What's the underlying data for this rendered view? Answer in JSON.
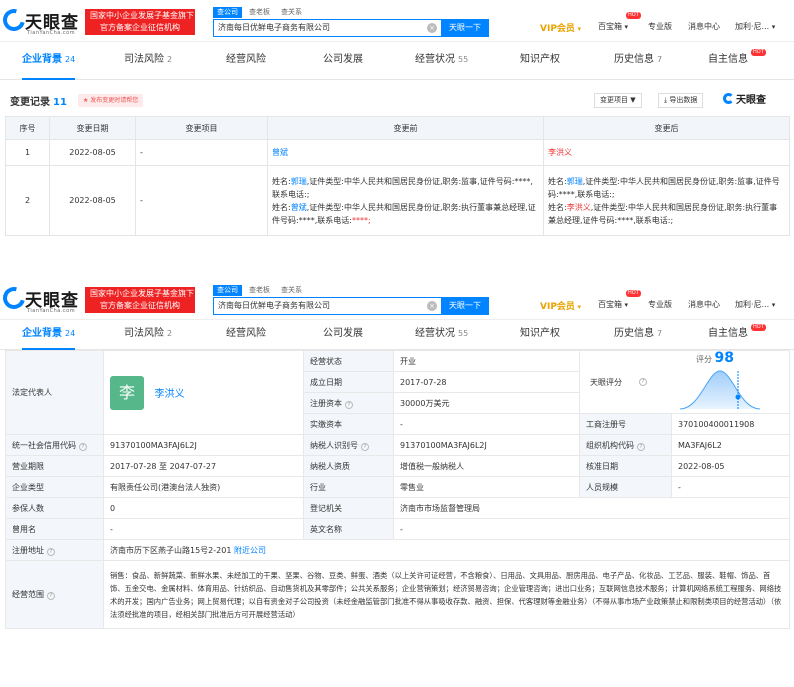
{
  "header": {
    "logo_text": "天眼查",
    "logo_sub": "TianYanCha.com",
    "promo_line1": "国家中小企业发展子基金旗下",
    "promo_line2": "官方备案企业征信机构",
    "search_tabs": [
      "查公司",
      "查老板",
      "查关系"
    ],
    "search_value": "济南每日优鲜电子商务有限公司",
    "search_clear": "×",
    "search_button": "天眼一下",
    "vip": "VIP会员",
    "baibao": "百宝箱",
    "hot": "HOT",
    "pro": "专业版",
    "messages": "消息中心",
    "user": "加利·尼..."
  },
  "tabs": [
    {
      "label": "企业背景",
      "count": "24"
    },
    {
      "label": "司法风险",
      "count": "2"
    },
    {
      "label": "经营风险",
      "count": ""
    },
    {
      "label": "公司发展",
      "count": ""
    },
    {
      "label": "经营状况",
      "count": "55"
    },
    {
      "label": "知识产权",
      "count": ""
    },
    {
      "label": "历史信息",
      "count": "7"
    },
    {
      "label": "自主信息",
      "count": ""
    }
  ],
  "change_section": {
    "title": "变更记录",
    "count": "11",
    "badge": "★ 发布变更时请帮您",
    "filter": "变更项目 ▼",
    "export": "⤓ 导出数据",
    "brand": "天眼查",
    "columns": [
      "序号",
      "变更日期",
      "变更项目",
      "变更前",
      "变更后"
    ],
    "rows": [
      {
        "index": "1",
        "date": "2022-08-05",
        "item": "-",
        "before_name": "曾斌",
        "after_name": "李洪义"
      },
      {
        "index": "2",
        "date": "2022-08-05",
        "item": "-",
        "before_1_prefix": "姓名:",
        "before_1_name": "郭瑞",
        "before_1_rest": ",证件类型:中华人民共和国居民身份证,职务:监事,证件号码:****,联系电话:;",
        "before_2_prefix": "姓名:",
        "before_2_name": "曾斌",
        "before_2_rest": ",证件类型:中华人民共和国居民身份证,职务:执行董事兼总经理,证件号码:****,联系电话:",
        "before_2_tail": "****;",
        "after_1_prefix": "姓名:",
        "after_1_name": "郭瑞",
        "after_1_rest": ",证件类型:中华人民共和国居民身份证,职务:监事,证件号码:****,联系电话:;",
        "after_2_prefix": "姓名:",
        "after_2_name": "李洪义",
        "after_2_rest": ",证件类型:中华人民共和国居民身份证,职务:执行董事兼总经理,证件号码:****,联系电话:;"
      }
    ]
  },
  "info": {
    "legal_rep_label": "法定代表人",
    "legal_rep_avatar": "李",
    "legal_rep_name": "李洪义",
    "status_label": "经营状态",
    "status_value": "开业",
    "score_label": "评分",
    "score_value": "98",
    "founded_label": "成立日期",
    "founded_value": "2017-07-28",
    "tianyan_score_label": "天眼评分",
    "reg_capital_label": "注册资本",
    "reg_capital_value": "30000万美元",
    "paid_capital_label": "实缴资本",
    "paid_capital_value": "-",
    "biz_reg_no_label": "工商注册号",
    "biz_reg_no_value": "370100400011908",
    "credit_code_label": "统一社会信用代码",
    "credit_code_value": "91370100MA3FAJ6L2J",
    "taxpayer_id_label": "纳税人识别号",
    "taxpayer_id_value": "91370100MA3FAJ6L2J",
    "org_code_label": "组织机构代码",
    "org_code_value": "MA3FAJ6L2",
    "term_label": "营业期限",
    "term_value": "2017-07-28 至 2047-07-27",
    "taxpayer_type_label": "纳税人资质",
    "taxpayer_type_value": "增值税一般纳税人",
    "approval_date_label": "核准日期",
    "approval_date_value": "2022-08-05",
    "company_type_label": "企业类型",
    "company_type_value": "有限责任公司(港澳台法人独资)",
    "industry_label": "行业",
    "industry_value": "零售业",
    "staff_size_label": "人员规模",
    "staff_size_value": "-",
    "insured_label": "参保人数",
    "insured_value": "0",
    "reg_authority_label": "登记机关",
    "reg_authority_value": "济南市市场监督管理局",
    "former_name_label": "曾用名",
    "former_name_value": "-",
    "english_name_label": "英文名称",
    "english_name_value": "-",
    "address_label": "注册地址",
    "address_value": "济南市历下区燕子山路15号2-201",
    "nearby_link": "附近公司",
    "scope_label": "经营范围",
    "scope_value": "销售：食品、新鲜蔬菜、新鲜水果、未经加工的干果、坚果、谷物、豆类、鲜蛋、酒类（以上关许可证经营，不含粮食）、日用品、文具用品、厨房用品、电子产品、化妆品、工艺品、服装、鞋帽、饰品、首饰、五金交电、金属材料、体育用品、针纺织品、自动售货机及其零部件；公共关系服务；企业营销策划；经济贸易咨询；企业管理咨询；进出口业务；互联网信息技术服务；计算机网络系统工程服务、网络技术的开发；国内广告业务；网上贸易代理；以自有资金对子公司投资（未经金融监管部门批准不得从事吸收存款、融资、担保、代客理财等金融业务）（不得从事市场产业政策禁止和限制类项目的经营活动）（依法须经批准的项目，经相关部门批准后方可开展经营活动）"
  },
  "colors": {
    "accent": "#0084ff",
    "promo": "#e22222",
    "vip": "#e8a200",
    "changed": "#e33333"
  }
}
